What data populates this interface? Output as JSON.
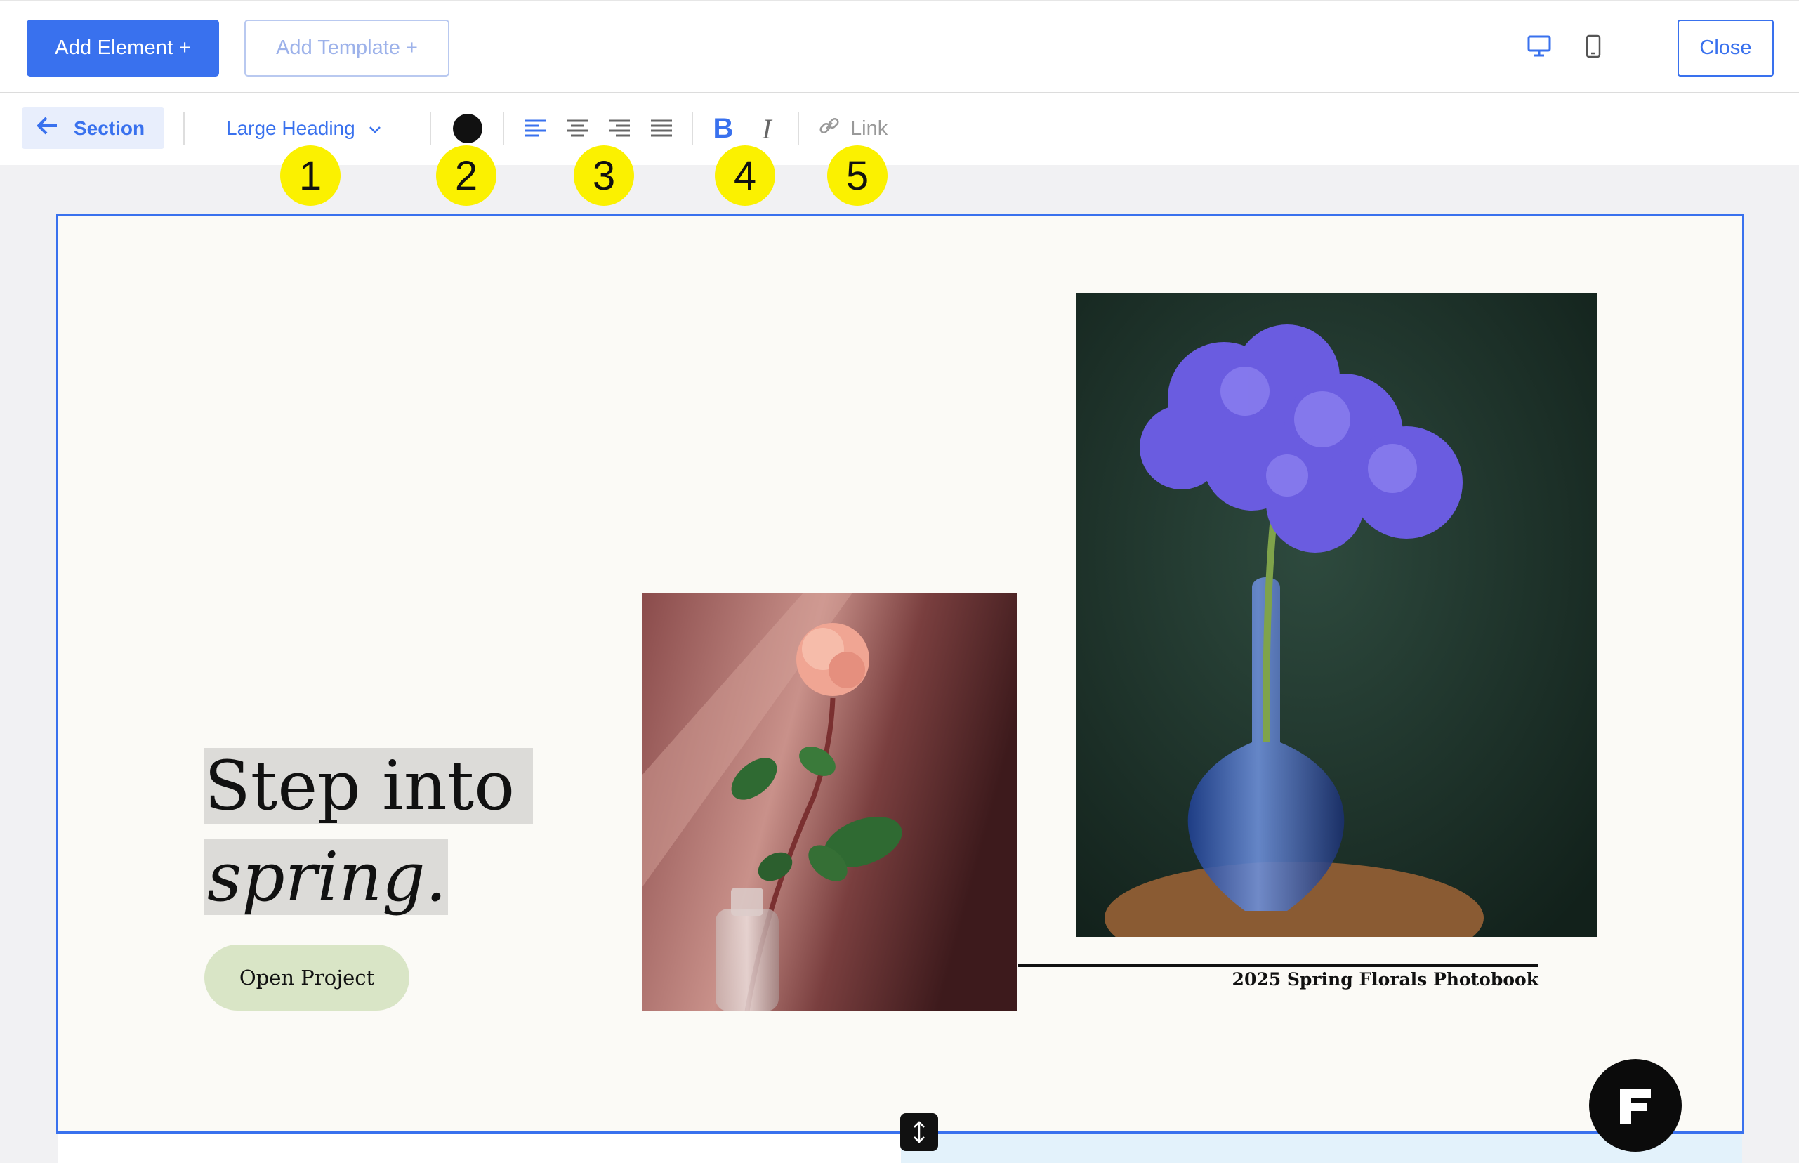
{
  "topbar": {
    "add_element_label": "Add Element +",
    "add_template_label": "Add Template +",
    "close_label": "Close",
    "device_icons": [
      "desktop-icon",
      "mobile-icon"
    ]
  },
  "toolbar": {
    "back_label": "Section",
    "heading_style": "Large Heading",
    "text_color": "#111111",
    "alignment_options": [
      "align-left",
      "align-center",
      "align-right",
      "align-justify"
    ],
    "bold_label": "B",
    "italic_label": "I",
    "link_label": "Link"
  },
  "markers": [
    "1",
    "2",
    "3",
    "4",
    "5"
  ],
  "section": {
    "heading_line1": "Step into",
    "heading_line2": "spring.",
    "button_label": "Open Project",
    "caption": "2025 Spring Florals Photobook",
    "images": [
      "pink rose in glass bottle",
      "purple hydrangea in blue glass vase"
    ]
  },
  "badge": {
    "letter": "F"
  },
  "colors": {
    "accent": "#3971ee",
    "marker": "#fbf100",
    "button_green": "#d9e5c6",
    "canvas": "#fbfaf6"
  }
}
